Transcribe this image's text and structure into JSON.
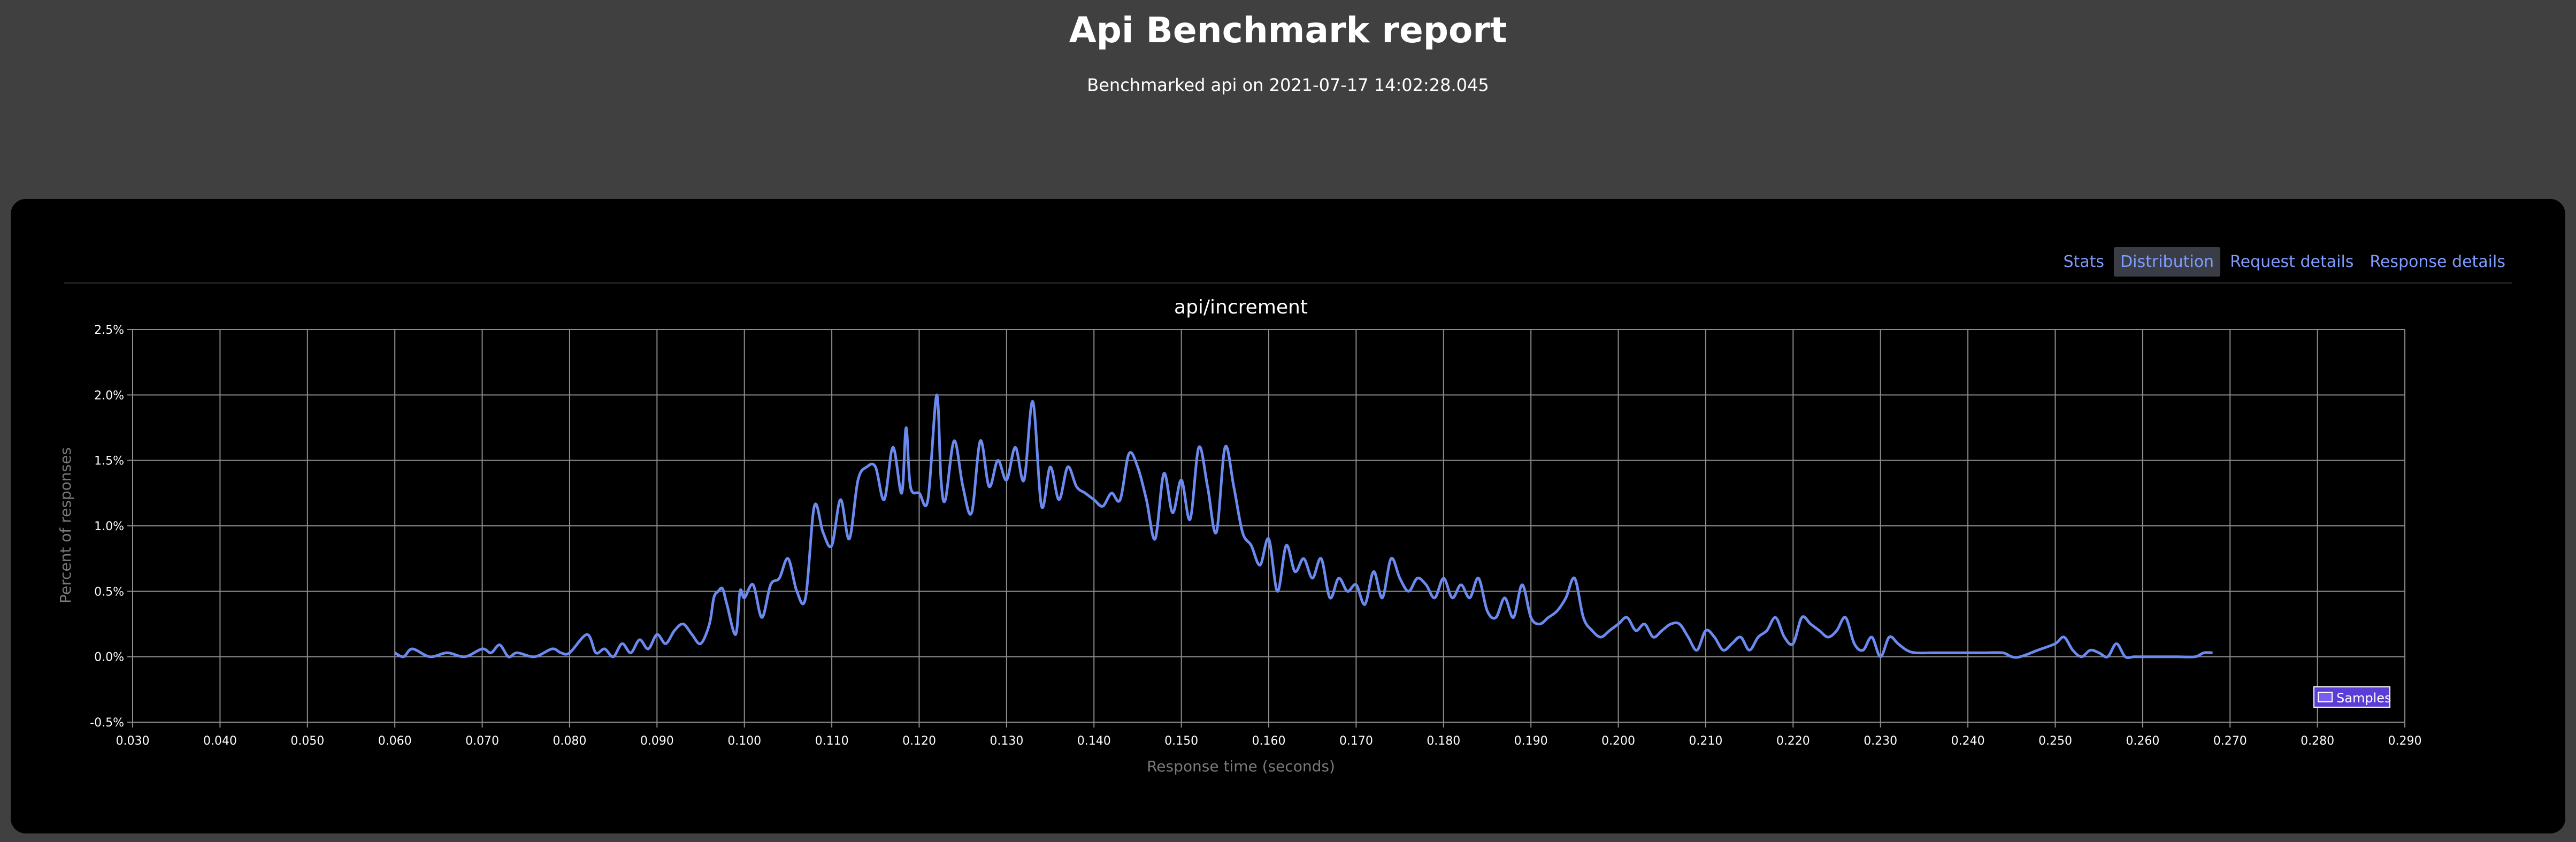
{
  "header": {
    "title": "Api Benchmark report",
    "subtitle": "Benchmarked api on 2021-07-17 14:02:28.045"
  },
  "tabs": [
    {
      "label": "Stats",
      "active": false
    },
    {
      "label": "Distribution",
      "active": true
    },
    {
      "label": "Request details",
      "active": false
    },
    {
      "label": "Response details",
      "active": false
    }
  ],
  "colors": {
    "line": "#6b8af0",
    "grid": "#8c8c8c",
    "legend_fill": "#5a3dd6"
  },
  "chart_data": {
    "type": "line",
    "title": "api/increment",
    "xlabel": "Response time (seconds)",
    "ylabel": "Percent of responses",
    "xlim": [
      0.03,
      0.29
    ],
    "ylim": [
      -0.5,
      2.5
    ],
    "x_ticks": [
      "0.030",
      "0.040",
      "0.050",
      "0.060",
      "0.070",
      "0.080",
      "0.090",
      "0.100",
      "0.110",
      "0.120",
      "0.130",
      "0.140",
      "0.150",
      "0.160",
      "0.170",
      "0.180",
      "0.190",
      "0.200",
      "0.210",
      "0.220",
      "0.230",
      "0.240",
      "0.250",
      "0.260",
      "0.270",
      "0.280",
      "0.290"
    ],
    "y_ticks": [
      "2.5%",
      "2.0%",
      "1.5%",
      "1.0%",
      "0.5%",
      "0.0%",
      "-0.5%"
    ],
    "grid": true,
    "legend_position": "bottom-right",
    "series": [
      {
        "name": "Samples",
        "x": [
          0.06,
          0.061,
          0.062,
          0.064,
          0.066,
          0.068,
          0.07,
          0.071,
          0.072,
          0.073,
          0.074,
          0.076,
          0.078,
          0.079,
          0.08,
          0.082,
          0.083,
          0.084,
          0.085,
          0.086,
          0.087,
          0.088,
          0.089,
          0.09,
          0.091,
          0.092,
          0.093,
          0.094,
          0.095,
          0.096,
          0.0965,
          0.097,
          0.0975,
          0.098,
          0.099,
          0.0995,
          0.1,
          0.101,
          0.102,
          0.103,
          0.104,
          0.105,
          0.106,
          0.107,
          0.108,
          0.109,
          0.11,
          0.111,
          0.112,
          0.113,
          0.114,
          0.115,
          0.116,
          0.117,
          0.118,
          0.1185,
          0.119,
          0.12,
          0.121,
          0.122,
          0.1225,
          0.123,
          0.124,
          0.125,
          0.126,
          0.127,
          0.128,
          0.129,
          0.13,
          0.131,
          0.132,
          0.133,
          0.134,
          0.135,
          0.136,
          0.137,
          0.138,
          0.139,
          0.14,
          0.141,
          0.142,
          0.143,
          0.144,
          0.145,
          0.146,
          0.147,
          0.148,
          0.149,
          0.15,
          0.151,
          0.152,
          0.153,
          0.154,
          0.155,
          0.156,
          0.157,
          0.158,
          0.159,
          0.16,
          0.161,
          0.162,
          0.163,
          0.164,
          0.165,
          0.166,
          0.167,
          0.168,
          0.169,
          0.17,
          0.171,
          0.172,
          0.173,
          0.174,
          0.175,
          0.176,
          0.177,
          0.178,
          0.179,
          0.18,
          0.181,
          0.182,
          0.183,
          0.184,
          0.185,
          0.186,
          0.187,
          0.188,
          0.189,
          0.19,
          0.191,
          0.192,
          0.193,
          0.194,
          0.195,
          0.196,
          0.197,
          0.198,
          0.199,
          0.2,
          0.201,
          0.202,
          0.203,
          0.204,
          0.205,
          0.206,
          0.207,
          0.208,
          0.209,
          0.21,
          0.211,
          0.212,
          0.213,
          0.214,
          0.215,
          0.216,
          0.217,
          0.218,
          0.219,
          0.22,
          0.221,
          0.222,
          0.223,
          0.224,
          0.225,
          0.226,
          0.227,
          0.228,
          0.229,
          0.23,
          0.231,
          0.232,
          0.233,
          0.234,
          0.236,
          0.238,
          0.24,
          0.242,
          0.244,
          0.245,
          0.246,
          0.248,
          0.25,
          0.251,
          0.252,
          0.253,
          0.254,
          0.255,
          0.256,
          0.257,
          0.258,
          0.259,
          0.26,
          0.262,
          0.264,
          0.266,
          0.267,
          0.268
        ],
        "values": [
          0.03,
          0.0,
          0.06,
          0.0,
          0.03,
          0.0,
          0.06,
          0.03,
          0.09,
          0.0,
          0.03,
          0.0,
          0.06,
          0.03,
          0.03,
          0.17,
          0.03,
          0.06,
          0.0,
          0.1,
          0.03,
          0.13,
          0.06,
          0.17,
          0.1,
          0.2,
          0.25,
          0.17,
          0.1,
          0.25,
          0.45,
          0.5,
          0.52,
          0.4,
          0.17,
          0.5,
          0.45,
          0.55,
          0.3,
          0.55,
          0.6,
          0.75,
          0.5,
          0.45,
          1.15,
          0.95,
          0.85,
          1.2,
          0.9,
          1.35,
          1.45,
          1.45,
          1.2,
          1.6,
          1.25,
          1.75,
          1.3,
          1.25,
          1.2,
          2.0,
          1.35,
          1.2,
          1.65,
          1.3,
          1.1,
          1.65,
          1.3,
          1.5,
          1.35,
          1.6,
          1.35,
          1.95,
          1.15,
          1.45,
          1.2,
          1.45,
          1.3,
          1.25,
          1.2,
          1.15,
          1.25,
          1.2,
          1.55,
          1.45,
          1.2,
          0.9,
          1.4,
          1.1,
          1.35,
          1.05,
          1.6,
          1.3,
          0.95,
          1.6,
          1.3,
          0.95,
          0.85,
          0.7,
          0.9,
          0.5,
          0.85,
          0.65,
          0.75,
          0.6,
          0.75,
          0.45,
          0.6,
          0.5,
          0.55,
          0.4,
          0.65,
          0.45,
          0.75,
          0.6,
          0.5,
          0.6,
          0.55,
          0.45,
          0.6,
          0.45,
          0.55,
          0.45,
          0.6,
          0.35,
          0.3,
          0.45,
          0.3,
          0.55,
          0.3,
          0.25,
          0.3,
          0.35,
          0.45,
          0.6,
          0.3,
          0.2,
          0.15,
          0.2,
          0.25,
          0.3,
          0.2,
          0.25,
          0.15,
          0.2,
          0.25,
          0.25,
          0.15,
          0.05,
          0.2,
          0.15,
          0.05,
          0.1,
          0.15,
          0.05,
          0.15,
          0.2,
          0.3,
          0.15,
          0.1,
          0.3,
          0.25,
          0.2,
          0.15,
          0.2,
          0.3,
          0.1,
          0.05,
          0.15,
          0.0,
          0.15,
          0.1,
          0.05,
          0.03,
          0.03,
          0.03,
          0.03,
          0.03,
          0.03,
          0.0,
          0.0,
          0.05,
          0.1,
          0.15,
          0.05,
          0.0,
          0.05,
          0.03,
          0.0,
          0.1,
          0.0,
          0.0,
          0.0,
          0.0,
          0.0,
          0.0,
          0.03,
          0.03
        ]
      }
    ]
  }
}
